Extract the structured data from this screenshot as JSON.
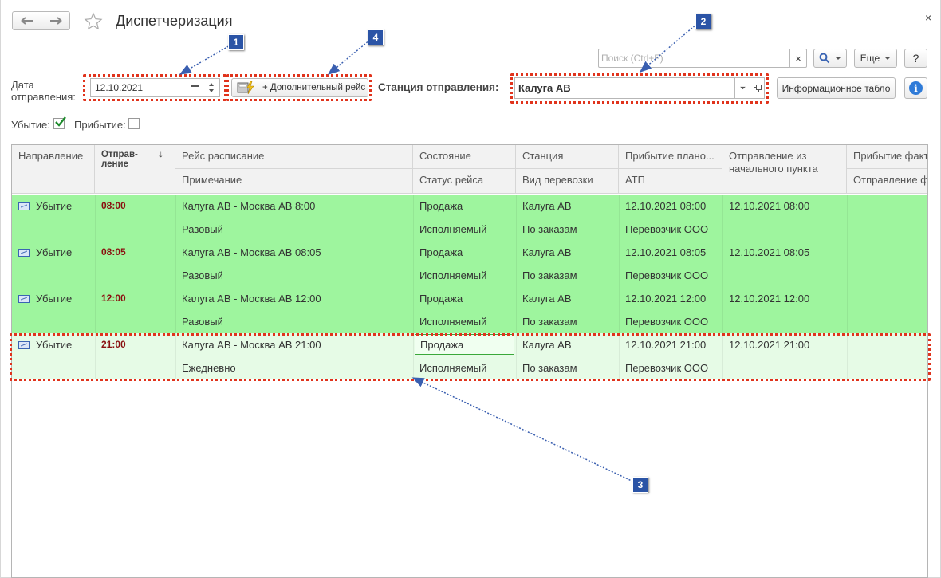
{
  "window": {
    "title": "Диспетчеризация",
    "close": "×"
  },
  "toolbar": {
    "search_placeholder": "Поиск (Ctrl+F)",
    "clear": "×",
    "more": "Еще",
    "help": "?",
    "info_board": "Информационное табло",
    "info": "i"
  },
  "filters": {
    "date_label": "Дата отправления:",
    "date_value": "12.10.2021",
    "extra_trip": "+ Дополнительный рейс",
    "station_label": "Станция отправления:",
    "station_value": "Калуга АВ",
    "departure_label": "Убытие:",
    "departure_checked": true,
    "arrival_label": "Прибытие:",
    "arrival_checked": false
  },
  "markers": [
    "1",
    "2",
    "3",
    "4"
  ],
  "grid": {
    "headers_top": [
      "Направление",
      "Отправ-ление",
      "Рейс расписание",
      "Состояние",
      "Станция",
      "Прибытие плано...",
      "Отправление из начального пункта",
      "Прибытие факти"
    ],
    "headers_bottom": [
      "Примечание",
      "Статус рейса",
      "Вид перевозки",
      "АТП",
      "Отправление фа"
    ],
    "sort_arrow": "↓",
    "rows": [
      {
        "direction": "Убытие",
        "time": "08:00",
        "route": "Калуга АВ - Москва АВ 8:00",
        "note": "Разовый",
        "state": "Продажа",
        "status": "Исполняемый",
        "station": "Калуга АВ",
        "kind": "По заказам",
        "arrival": "12.10.2021 08:00",
        "atp": "Перевозчик ООО",
        "origin_dep": "12.10.2021 08:00"
      },
      {
        "direction": "Убытие",
        "time": "08:05",
        "route": "Калуга АВ - Москва АВ 08:05",
        "note": "Разовый",
        "state": "Продажа",
        "status": "Исполняемый",
        "station": "Калуга АВ",
        "kind": "По заказам",
        "arrival": "12.10.2021 08:05",
        "atp": "Перевозчик ООО",
        "origin_dep": "12.10.2021 08:05"
      },
      {
        "direction": "Убытие",
        "time": "12:00",
        "route": "Калуга АВ - Москва АВ 12:00",
        "note": "Разовый",
        "state": "Продажа",
        "status": "Исполняемый",
        "station": "Калуга АВ",
        "kind": "По заказам",
        "arrival": "12.10.2021 12:00",
        "atp": "Перевозчик ООО",
        "origin_dep": "12.10.2021 12:00"
      },
      {
        "direction": "Убытие",
        "time": "21:00",
        "route": "Калуга АВ - Москва АВ 21:00",
        "note": "Ежедневно",
        "state": "Продажа",
        "status": "Исполняемый",
        "station": "Калуга АВ",
        "kind": "По заказам",
        "arrival": "12.10.2021 21:00",
        "atp": "Перевозчик ООО",
        "origin_dep": "12.10.2021 21:00"
      }
    ]
  },
  "colors": {
    "row_green": "#9ef59e",
    "row_selected": "#e6fbe6",
    "highlight": "#e0331c",
    "marker": "#2b54a6",
    "dep_time": "#8a1010"
  }
}
